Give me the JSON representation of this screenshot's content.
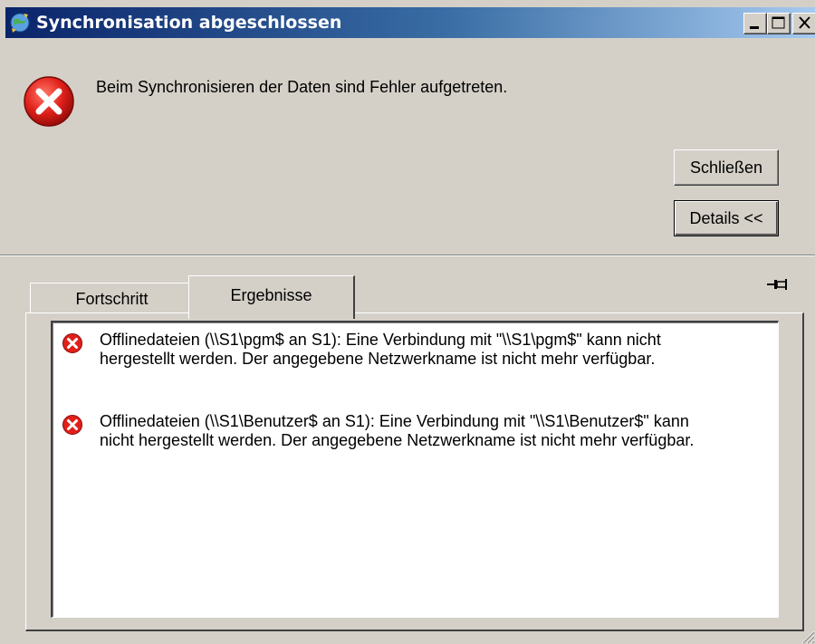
{
  "window": {
    "title": "Synchronisation abgeschlossen",
    "title_icon": "sync-globe-icon",
    "controls": {
      "minimize": "minimize-icon",
      "maximize": "maximize-icon",
      "close": "close-icon"
    }
  },
  "message": {
    "icon": "error-icon",
    "text": "Beim Synchronisieren der Daten sind Fehler aufgetreten."
  },
  "buttons": {
    "close_label": "Schließen",
    "details_label": "Details <<"
  },
  "pin_icon": "pin-icon",
  "tabs": [
    {
      "label": "Fortschritt",
      "selected": false
    },
    {
      "label": "Ergebnisse",
      "selected": true
    }
  ],
  "results": [
    {
      "icon": "error-icon",
      "line1": "Offlinedateien (\\\\S1\\pgm$ an S1): Eine Verbindung mit \"\\\\S1\\pgm$\" kann nicht",
      "line2": "hergestellt werden. Der angegebene Netzwerkname ist nicht mehr verfügbar."
    },
    {
      "icon": "error-icon",
      "line1": "Offlinedateien (\\\\S1\\Benutzer$ an S1): Eine Verbindung mit \"\\\\S1\\Benutzer$\" kann",
      "line2": "nicht hergestellt werden. Der angegebene Netzwerkname ist nicht mehr verfügbar."
    }
  ],
  "colors": {
    "titlebar_start": "#0a246a",
    "titlebar_end": "#a6caf0",
    "dialog_face": "#d4d0c8",
    "error_red": "#e0201a"
  }
}
